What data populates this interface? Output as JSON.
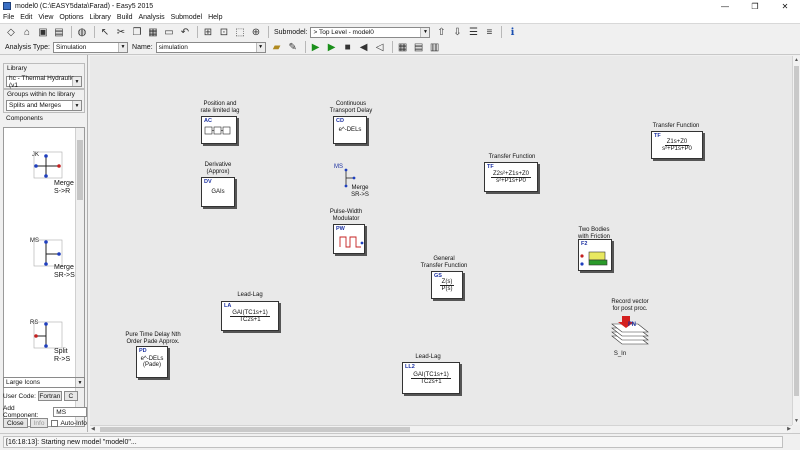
{
  "window": {
    "title": "model0 (C:\\EASY5data\\Farad) - Easy5 2015"
  },
  "menu": [
    "File",
    "Edit",
    "View",
    "Options",
    "Library",
    "Build",
    "Analysis",
    "Submodel",
    "Help"
  ],
  "toolbar": {
    "submodel_label": "Submodel:",
    "submodel_value": "> Top Level - model0"
  },
  "analysis": {
    "type_label": "Analysis Type:",
    "type_value": "Simulation",
    "name_label": "Name:",
    "name_value": "simulation"
  },
  "library": {
    "title": "Library",
    "value": "hc - Thermal Hydraulic (v1",
    "groups_title": "Groups within hc library",
    "groups_value": "Splits and Merges",
    "components_title": "Components",
    "components": [
      {
        "code": "JK",
        "label": "Merge\nS->R"
      },
      {
        "code": "MS",
        "label": "Merge\nSR->S"
      },
      {
        "code": "RS",
        "label": "Split\nR->S"
      }
    ],
    "icon_size": "Large Icons",
    "user_code_label": "User Code:",
    "user_code_fortran": "Fortran",
    "user_code_c": "C",
    "add_component_label": "Add Component:",
    "add_component_value": "MS",
    "close_label": "Close",
    "info_label": "Info",
    "auto_info_label": "Auto-Info"
  },
  "blocks": [
    {
      "id": "AC",
      "label": "Position and\nrate limited lag",
      "body": ""
    },
    {
      "id": "CD",
      "label": "Continuous\nTransport Delay",
      "body": "e^-DELs"
    },
    {
      "id": "DV",
      "label": "Derivative\n(Approx)",
      "body": "GAIs"
    },
    {
      "id": "MS",
      "label": "Merge\nSR->S",
      "body": ""
    },
    {
      "id": "TF",
      "label": "Transfer Function",
      "num": "Z1s+Z0",
      "den": "s²+P1s+P0"
    },
    {
      "id": "TF",
      "label": "Transfer Function",
      "num": "Z2s²+Z1s+Z0",
      "den": "s²+P1s+P0"
    },
    {
      "id": "PW",
      "label": "Pulse-Width\nModulator",
      "body": ""
    },
    {
      "id": "F2",
      "label": "Two Bodies\nwith Friction",
      "body": ""
    },
    {
      "id": "GS",
      "label": "General\nTransfer Function",
      "num": "Z(s)",
      "den": "P(s)"
    },
    {
      "id": "LA",
      "label": "Lead-Lag",
      "num": "GAI(TC1s+1)",
      "den": "TC2s+1"
    },
    {
      "id": "PD",
      "label": "Pure Time Delay Nth\nOrder Pade Approx.",
      "body": "e^-DELs\n(Pade)"
    },
    {
      "id": "LL2",
      "label": "Lead-Lag",
      "num": "GAI(TC1s+1)",
      "den": "TC2s+1"
    },
    {
      "id": "FN",
      "label": "Record vector\nfor post proc.",
      "sub": "S_In"
    }
  ],
  "status": {
    "text": "[16:18:13]: Starting new model \"model0\"..."
  },
  "colors": {
    "block_code": "#1a2fa0",
    "play_green": "#1a8f1a",
    "port_blue": "#1f3fbf",
    "port_red": "#c42020"
  }
}
